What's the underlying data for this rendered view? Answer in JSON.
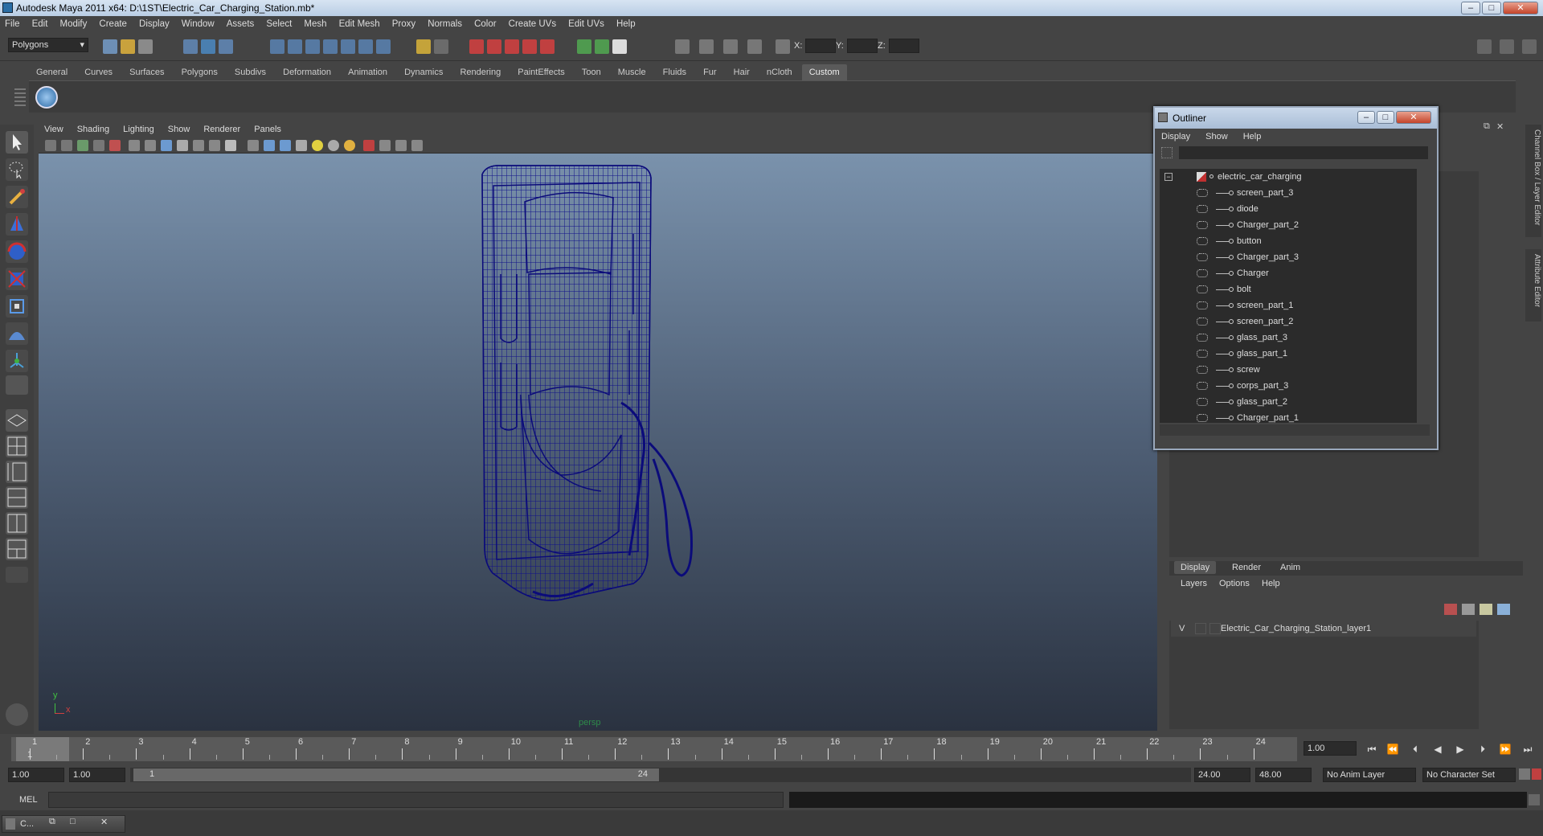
{
  "window": {
    "title": "Autodesk Maya 2011 x64: D:\\1ST\\Electric_Car_Charging_Station.mb*",
    "minimize": "–",
    "maximize": "□",
    "close": "✕"
  },
  "menubar": [
    "File",
    "Edit",
    "Modify",
    "Create",
    "Display",
    "Window",
    "Assets",
    "Select",
    "Mesh",
    "Edit Mesh",
    "Proxy",
    "Normals",
    "Color",
    "Create UVs",
    "Edit UVs",
    "Help"
  ],
  "statusline": {
    "mode": "Polygons",
    "x_label": "X:",
    "y_label": "Y:",
    "z_label": "Z:"
  },
  "shelf_tabs": [
    "General",
    "Curves",
    "Surfaces",
    "Polygons",
    "Subdivs",
    "Deformation",
    "Animation",
    "Dynamics",
    "Rendering",
    "PaintEffects",
    "Toon",
    "Muscle",
    "Fluids",
    "Fur",
    "Hair",
    "nCloth",
    "Custom"
  ],
  "shelf_active": "Custom",
  "viewport": {
    "menu": [
      "View",
      "Shading",
      "Lighting",
      "Show",
      "Renderer",
      "Panels"
    ],
    "camera_label": "persp",
    "axis_y": "y",
    "axis_x": "x",
    "wire_color": "#0b0b7a"
  },
  "outliner": {
    "title": "Outliner",
    "menu": [
      "Display",
      "Show",
      "Help"
    ],
    "root": "electric_car_charging",
    "items": [
      "screen_part_3",
      "diode",
      "Charger_part_2",
      "button",
      "Charger_part_3",
      "Charger",
      "bolt",
      "screen_part_1",
      "screen_part_2",
      "glass_part_3",
      "glass_part_1",
      "screw",
      "corps_part_3",
      "glass_part_2",
      "Charger_part_1"
    ]
  },
  "right_tabs": {
    "channel_box": "Channel Box / Layer Editor",
    "attribute_editor": "Attribute Editor"
  },
  "layer_editor": {
    "tabs": [
      "Display",
      "Render",
      "Anim"
    ],
    "menu": [
      "Layers",
      "Options",
      "Help"
    ],
    "layer_visible": "V",
    "layer_name": "Electric_Car_Charging_Station_layer1"
  },
  "timeline": {
    "ticks": [
      "1",
      "2",
      "3",
      "4",
      "5",
      "6",
      "7",
      "8",
      "9",
      "10",
      "11",
      "12",
      "13",
      "14",
      "15",
      "16",
      "17",
      "18",
      "19",
      "20",
      "21",
      "22",
      "23",
      "24"
    ],
    "current": "1",
    "current_frame_field": "1.00"
  },
  "range": {
    "start": "1.00",
    "playback_start": "1.00",
    "slider_start": "1",
    "slider_end": "24",
    "playback_end": "24.00",
    "end": "48.00",
    "anim_layer": "No Anim Layer",
    "character_set": "No Character Set"
  },
  "command_line": {
    "label": "MEL"
  },
  "taskbar": {
    "window_label": "C..."
  }
}
